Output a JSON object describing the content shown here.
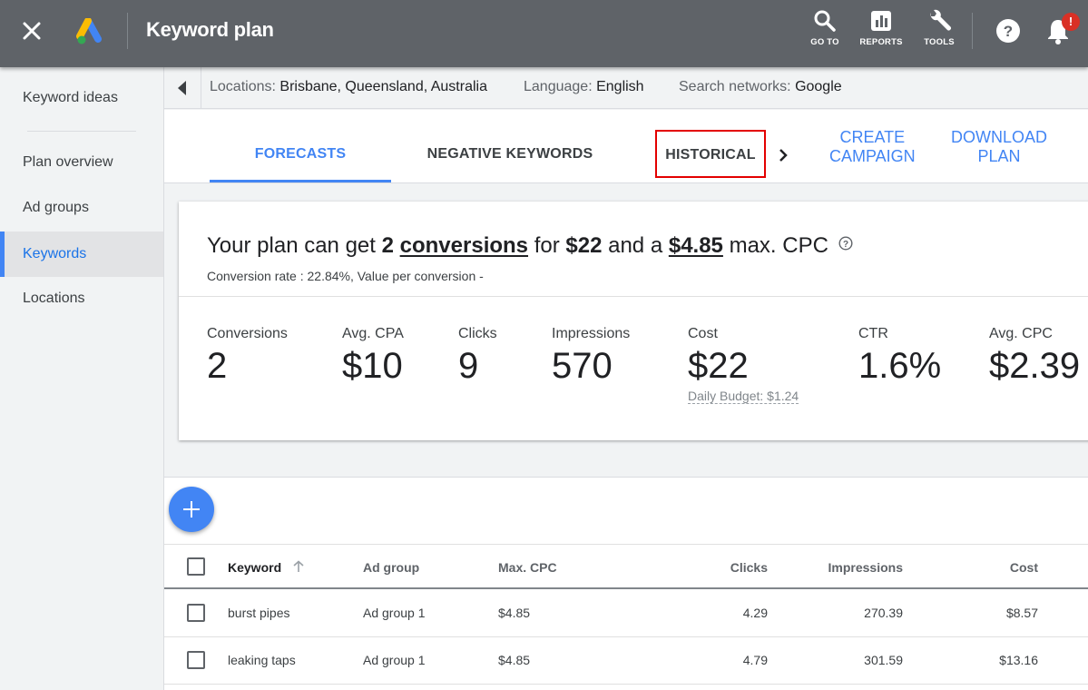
{
  "topbar": {
    "title": "Keyword plan",
    "tools": [
      {
        "label": "GO TO",
        "icon": "search-icon"
      },
      {
        "label": "REPORTS",
        "icon": "reports-icon"
      },
      {
        "label": "TOOLS",
        "icon": "wrench-icon"
      }
    ],
    "notification_badge": "!"
  },
  "sidebar": {
    "items": [
      {
        "label": "Keyword ideas",
        "active": false
      },
      {
        "label": "Plan overview",
        "active": false
      },
      {
        "label": "Ad groups",
        "active": false
      },
      {
        "label": "Keywords",
        "active": true
      },
      {
        "label": "Locations",
        "active": false
      }
    ]
  },
  "filters": {
    "locations_key": "Locations:",
    "locations_value": "Brisbane, Queensland, Australia",
    "language_key": "Language:",
    "language_value": "English",
    "networks_key": "Search networks:",
    "networks_value": "Google"
  },
  "tabs": {
    "forecasts": "FORECASTS",
    "negative": "NEGATIVE KEYWORDS",
    "historical": "HISTORICAL",
    "create_line1": "CREATE",
    "create_line2": "CAMPAIGN",
    "download_line1": "DOWNLOAD",
    "download_line2": "PLAN"
  },
  "summary": {
    "headline_pre": "Your plan can get",
    "conversions_num": "2",
    "conversions_word": "conversions",
    "for_word": "for",
    "cost": "$22",
    "and_a": "and a",
    "max_cpc": "$4.85",
    "max_cpc_suffix": "max. CPC",
    "subline": "Conversion rate : 22.84%, Value per conversion -",
    "metrics": [
      {
        "label": "Conversions",
        "value": "2"
      },
      {
        "label": "Avg. CPA",
        "value": "$10"
      },
      {
        "label": "Clicks",
        "value": "9"
      },
      {
        "label": "Impressions",
        "value": "570"
      },
      {
        "label": "Cost",
        "value": "$22",
        "sub": "Daily Budget: $1.24"
      },
      {
        "label": "CTR",
        "value": "1.6%"
      },
      {
        "label": "Avg. CPC",
        "value": "$2.39"
      }
    ]
  },
  "table": {
    "headers": {
      "keyword": "Keyword",
      "ad_group": "Ad group",
      "max_cpc": "Max. CPC",
      "clicks": "Clicks",
      "impressions": "Impressions",
      "cost": "Cost"
    },
    "rows": [
      {
        "keyword": "burst pipes",
        "ad_group": "Ad group 1",
        "max_cpc": "$4.85",
        "clicks": "4.29",
        "impressions": "270.39",
        "cost": "$8.57"
      },
      {
        "keyword": "leaking taps",
        "ad_group": "Ad group 1",
        "max_cpc": "$4.85",
        "clicks": "4.79",
        "impressions": "301.59",
        "cost": "$13.16"
      }
    ]
  },
  "colors": {
    "accent": "#4285f4",
    "topbar": "#5f6368",
    "highlight_box": "#e30000",
    "badge": "#d93025"
  }
}
